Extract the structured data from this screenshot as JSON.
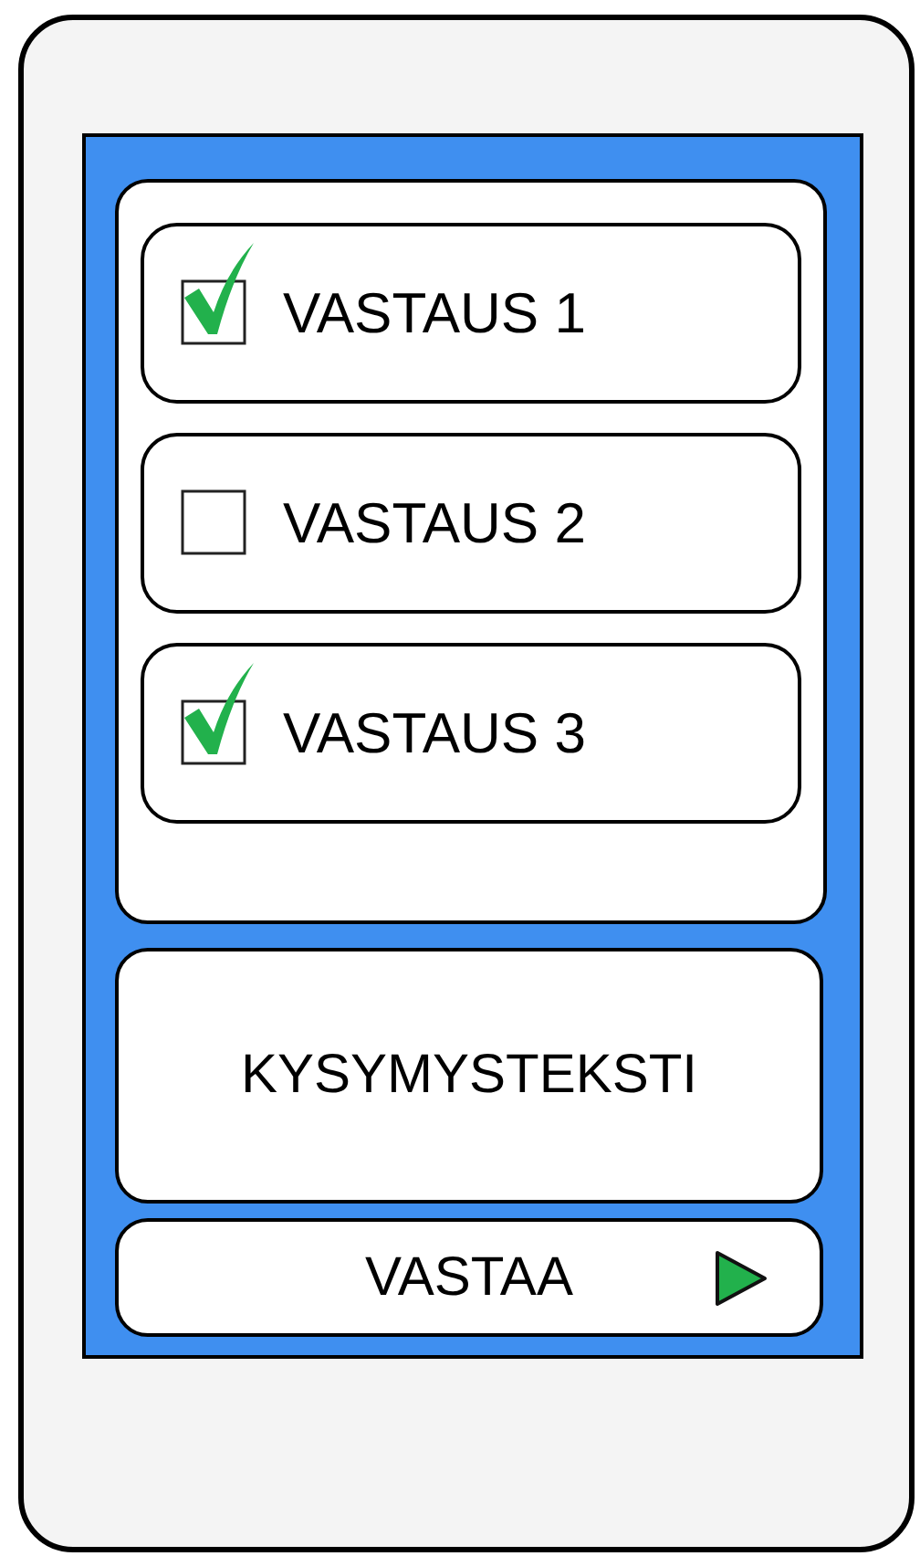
{
  "answers": [
    {
      "label": "VASTAUS 1",
      "checked": true
    },
    {
      "label": "VASTAUS 2",
      "checked": false
    },
    {
      "label": "VASTAUS 3",
      "checked": true
    }
  ],
  "question": "KYSYMYSTEKSTI",
  "submit_button": {
    "label": "VASTAA"
  }
}
